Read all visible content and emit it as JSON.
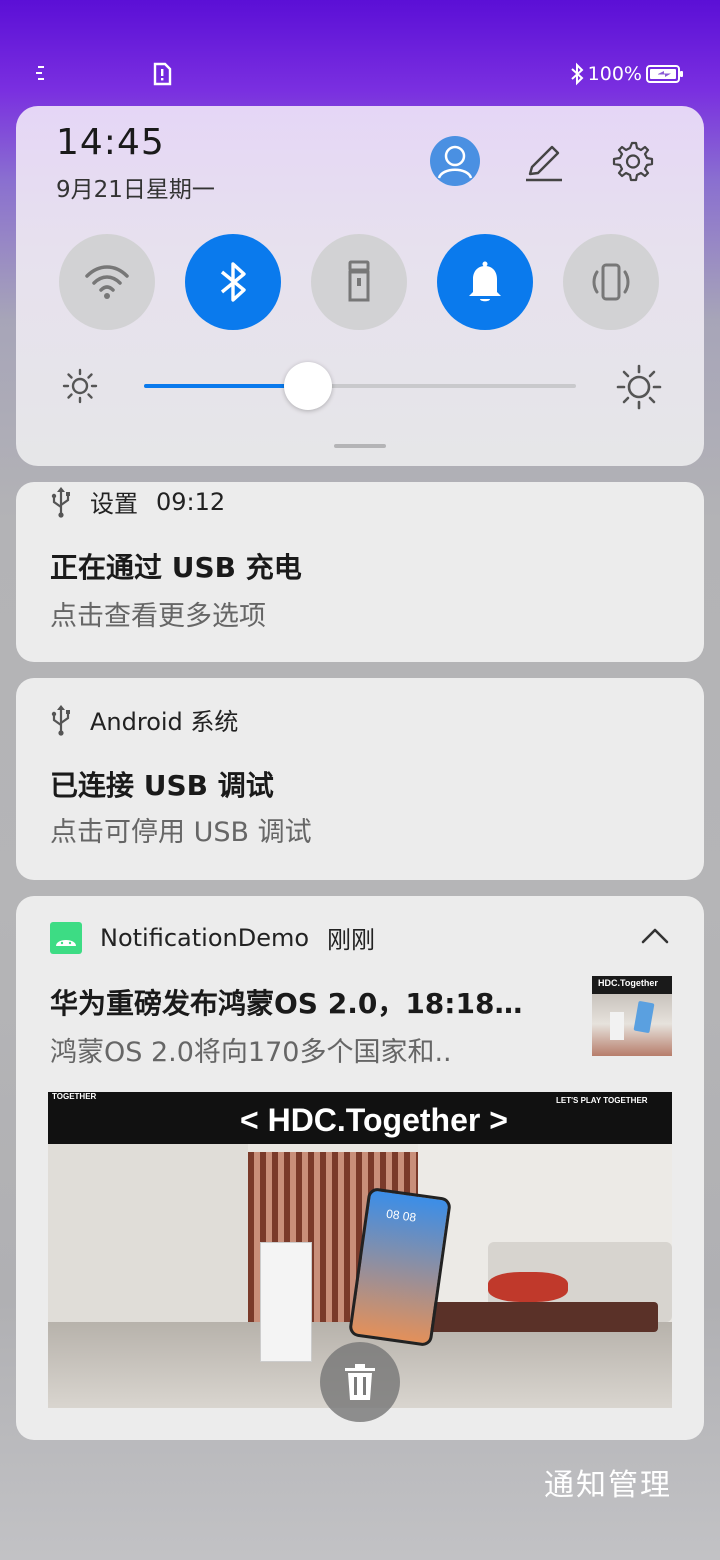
{
  "status_bar": {
    "battery_text": "100%",
    "icons": [
      "signal-dots-icon",
      "document-alert-icon",
      "bluetooth-icon",
      "battery-charging-icon"
    ]
  },
  "control_center": {
    "time": "14:45",
    "date": "9月21日星期一",
    "toggles": [
      {
        "name": "wifi",
        "on": false
      },
      {
        "name": "bluetooth",
        "on": true
      },
      {
        "name": "flashlight",
        "on": false
      },
      {
        "name": "sound",
        "on": true
      },
      {
        "name": "vibrate",
        "on": false
      }
    ],
    "brightness": 0.38,
    "accent": "#0a7aed"
  },
  "notifications": [
    {
      "app": "设置",
      "time": "09:12",
      "title": "正在通过 USB 充电",
      "text": "点击查看更多选项"
    },
    {
      "app": "Android 系统",
      "title": "已连接 USB 调试",
      "text": "点击可停用 USB 调试"
    },
    {
      "app": "NotificationDemo",
      "time": "刚刚",
      "title": "华为重磅发布鸿蒙OS 2.0，18:18…",
      "text": "鸿蒙OS 2.0将向170多个国家和..",
      "thumbnail_text": "HDC.Together",
      "image": {
        "left_tag": "TOGETHER",
        "headline": "< HDC.Together >",
        "right_tag": "LET'S PLAY TOGETHER",
        "phone_time": "08 08"
      }
    }
  ],
  "footer": {
    "manage_label": "通知管理"
  }
}
